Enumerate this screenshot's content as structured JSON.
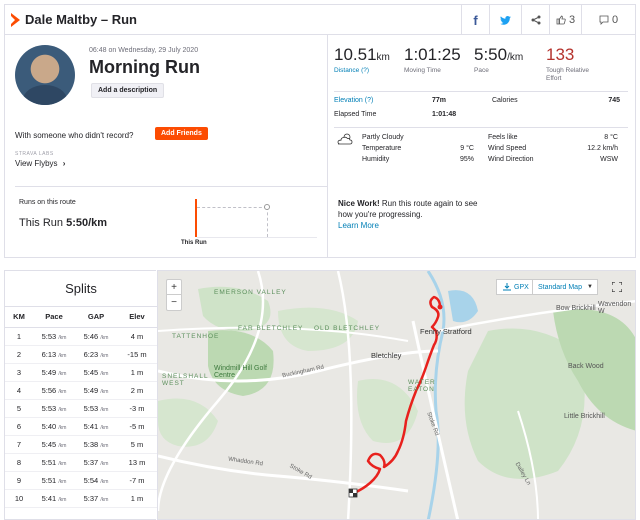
{
  "header": {
    "title": "Dale Maltby – Run",
    "share_count": "",
    "kudos_count": "3",
    "comment_count": "0"
  },
  "activity": {
    "datetime": "06:48 on Wednesday, 29 July 2020",
    "title": "Morning Run",
    "add_description_label": "Add a description",
    "with_someone_text": "With someone who didn't record?",
    "add_friends_label": "Add Friends",
    "labs_label": "STRAVA LABS",
    "flybys_label": "View Flybys"
  },
  "stats": {
    "distance": {
      "value": "10.51",
      "unit": "km",
      "label": "Distance (?)"
    },
    "moving_time": {
      "value": "1:01:25",
      "label": "Moving Time"
    },
    "pace": {
      "value": "5:50",
      "unit": "/km",
      "label": "Pace"
    },
    "effort": {
      "value": "133",
      "label": "Tough Relative Effort"
    },
    "elevation_label": "Elevation (?)",
    "elevation_value": "77m",
    "calories_label": "Calories",
    "calories_value": "745",
    "elapsed_label": "Elapsed Time",
    "elapsed_value": "1:01:48"
  },
  "weather": {
    "condition": "Partly Cloudy",
    "temperature_label": "Temperature",
    "temperature_value": "9 °C",
    "humidity_label": "Humidity",
    "humidity_value": "95%",
    "feels_like_label": "Feels like",
    "feels_like_value": "8 °C",
    "wind_speed_label": "Wind Speed",
    "wind_speed_value": "12.2 km/h",
    "wind_direction_label": "Wind Direction",
    "wind_direction_value": "WSW"
  },
  "route": {
    "runs_on_route_label": "Runs on this route",
    "this_run_label": "This Run",
    "this_run_value": "5:50/km",
    "graph_label": "This Run",
    "nice_work_bold": "Nice Work!",
    "nice_work_text": "Run this route again to see how you're progressing.",
    "learn_more_label": "Learn More"
  },
  "splits": {
    "title": "Splits",
    "columns": [
      "KM",
      "Pace",
      "GAP",
      "Elev"
    ],
    "pace_unit": "/km",
    "rows": [
      {
        "km": "1",
        "pace": "5:53",
        "gap": "5:46",
        "elev": "4 m"
      },
      {
        "km": "2",
        "pace": "6:13",
        "gap": "6:23",
        "elev": "-15 m"
      },
      {
        "km": "3",
        "pace": "5:49",
        "gap": "5:45",
        "elev": "1 m"
      },
      {
        "km": "4",
        "pace": "5:56",
        "gap": "5:49",
        "elev": "2 m"
      },
      {
        "km": "5",
        "pace": "5:53",
        "gap": "5:53",
        "elev": "-3 m"
      },
      {
        "km": "6",
        "pace": "5:40",
        "gap": "5:41",
        "elev": "-5 m"
      },
      {
        "km": "7",
        "pace": "5:45",
        "gap": "5:38",
        "elev": "5 m"
      },
      {
        "km": "8",
        "pace": "5:51",
        "gap": "5:37",
        "elev": "13 m"
      },
      {
        "km": "9",
        "pace": "5:51",
        "gap": "5:54",
        "elev": "-7 m"
      },
      {
        "km": "10",
        "pace": "5:41",
        "gap": "5:37",
        "elev": "1 m"
      }
    ]
  },
  "map": {
    "zoom_in": "+",
    "zoom_out": "−",
    "gpx_label": "GPX",
    "map_type_label": "Standard Map",
    "labels": {
      "emerson_valley": "Emerson Valley",
      "far_bletchley": "Far Bletchley",
      "old_bletchley": "Old Bletchley",
      "bletchley": "Bletchley",
      "fenny_stratford": "Fenny Stratford",
      "water_eaton": "Water Eaton",
      "windmill_hill": "Windmill Hill Golf Centre",
      "snelshall_west": "Snelshall West",
      "tattenhoe": "Tattenhoe",
      "back_wood": "Back Wood",
      "little_brickhill": "Little Brickhill",
      "bow_brickhill": "Bow Brickhill",
      "wavendon": "Wavendon W",
      "buckingham_rd": "Buckingham Rd",
      "whaddon_rd": "Whaddon Rd",
      "stoke_rd": "Stoke Rd",
      "stoke_rd2": "Stoke Rd",
      "dalley_ln": "Dalley Ln"
    }
  }
}
